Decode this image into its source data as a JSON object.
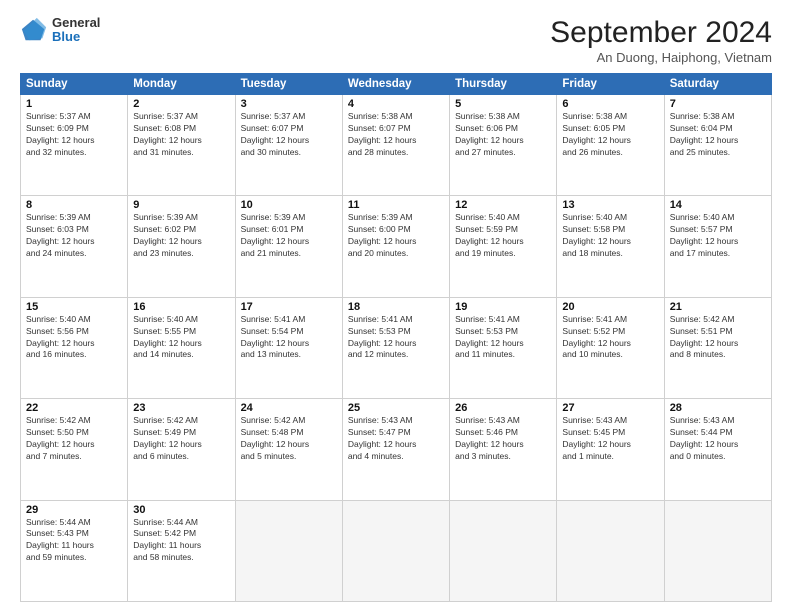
{
  "header": {
    "logo_general": "General",
    "logo_blue": "Blue",
    "month_title": "September 2024",
    "location": "An Duong, Haiphong, Vietnam"
  },
  "weekdays": [
    "Sunday",
    "Monday",
    "Tuesday",
    "Wednesday",
    "Thursday",
    "Friday",
    "Saturday"
  ],
  "weeks": [
    [
      {
        "day": 1,
        "rise": "5:37 AM",
        "set": "6:09 PM",
        "daylight": "12 hours and 32 minutes."
      },
      {
        "day": 2,
        "rise": "5:37 AM",
        "set": "6:08 PM",
        "daylight": "12 hours and 31 minutes."
      },
      {
        "day": 3,
        "rise": "5:37 AM",
        "set": "6:07 PM",
        "daylight": "12 hours and 30 minutes."
      },
      {
        "day": 4,
        "rise": "5:38 AM",
        "set": "6:07 PM",
        "daylight": "12 hours and 28 minutes."
      },
      {
        "day": 5,
        "rise": "5:38 AM",
        "set": "6:06 PM",
        "daylight": "12 hours and 27 minutes."
      },
      {
        "day": 6,
        "rise": "5:38 AM",
        "set": "6:05 PM",
        "daylight": "12 hours and 26 minutes."
      },
      {
        "day": 7,
        "rise": "5:38 AM",
        "set": "6:04 PM",
        "daylight": "12 hours and 25 minutes."
      }
    ],
    [
      {
        "day": 8,
        "rise": "5:39 AM",
        "set": "6:03 PM",
        "daylight": "12 hours and 24 minutes."
      },
      {
        "day": 9,
        "rise": "5:39 AM",
        "set": "6:02 PM",
        "daylight": "12 hours and 23 minutes."
      },
      {
        "day": 10,
        "rise": "5:39 AM",
        "set": "6:01 PM",
        "daylight": "12 hours and 21 minutes."
      },
      {
        "day": 11,
        "rise": "5:39 AM",
        "set": "6:00 PM",
        "daylight": "12 hours and 20 minutes."
      },
      {
        "day": 12,
        "rise": "5:40 AM",
        "set": "5:59 PM",
        "daylight": "12 hours and 19 minutes."
      },
      {
        "day": 13,
        "rise": "5:40 AM",
        "set": "5:58 PM",
        "daylight": "12 hours and 18 minutes."
      },
      {
        "day": 14,
        "rise": "5:40 AM",
        "set": "5:57 PM",
        "daylight": "12 hours and 17 minutes."
      }
    ],
    [
      {
        "day": 15,
        "rise": "5:40 AM",
        "set": "5:56 PM",
        "daylight": "12 hours and 16 minutes."
      },
      {
        "day": 16,
        "rise": "5:40 AM",
        "set": "5:55 PM",
        "daylight": "12 hours and 14 minutes."
      },
      {
        "day": 17,
        "rise": "5:41 AM",
        "set": "5:54 PM",
        "daylight": "12 hours and 13 minutes."
      },
      {
        "day": 18,
        "rise": "5:41 AM",
        "set": "5:53 PM",
        "daylight": "12 hours and 12 minutes."
      },
      {
        "day": 19,
        "rise": "5:41 AM",
        "set": "5:53 PM",
        "daylight": "12 hours and 11 minutes."
      },
      {
        "day": 20,
        "rise": "5:41 AM",
        "set": "5:52 PM",
        "daylight": "12 hours and 10 minutes."
      },
      {
        "day": 21,
        "rise": "5:42 AM",
        "set": "5:51 PM",
        "daylight": "12 hours and 8 minutes."
      }
    ],
    [
      {
        "day": 22,
        "rise": "5:42 AM",
        "set": "5:50 PM",
        "daylight": "12 hours and 7 minutes."
      },
      {
        "day": 23,
        "rise": "5:42 AM",
        "set": "5:49 PM",
        "daylight": "12 hours and 6 minutes."
      },
      {
        "day": 24,
        "rise": "5:42 AM",
        "set": "5:48 PM",
        "daylight": "12 hours and 5 minutes."
      },
      {
        "day": 25,
        "rise": "5:43 AM",
        "set": "5:47 PM",
        "daylight": "12 hours and 4 minutes."
      },
      {
        "day": 26,
        "rise": "5:43 AM",
        "set": "5:46 PM",
        "daylight": "12 hours and 3 minutes."
      },
      {
        "day": 27,
        "rise": "5:43 AM",
        "set": "5:45 PM",
        "daylight": "12 hours and 1 minute."
      },
      {
        "day": 28,
        "rise": "5:43 AM",
        "set": "5:44 PM",
        "daylight": "12 hours and 0 minutes."
      }
    ],
    [
      {
        "day": 29,
        "rise": "5:44 AM",
        "set": "5:43 PM",
        "daylight": "11 hours and 59 minutes."
      },
      {
        "day": 30,
        "rise": "5:44 AM",
        "set": "5:42 PM",
        "daylight": "11 hours and 58 minutes."
      },
      null,
      null,
      null,
      null,
      null
    ]
  ]
}
